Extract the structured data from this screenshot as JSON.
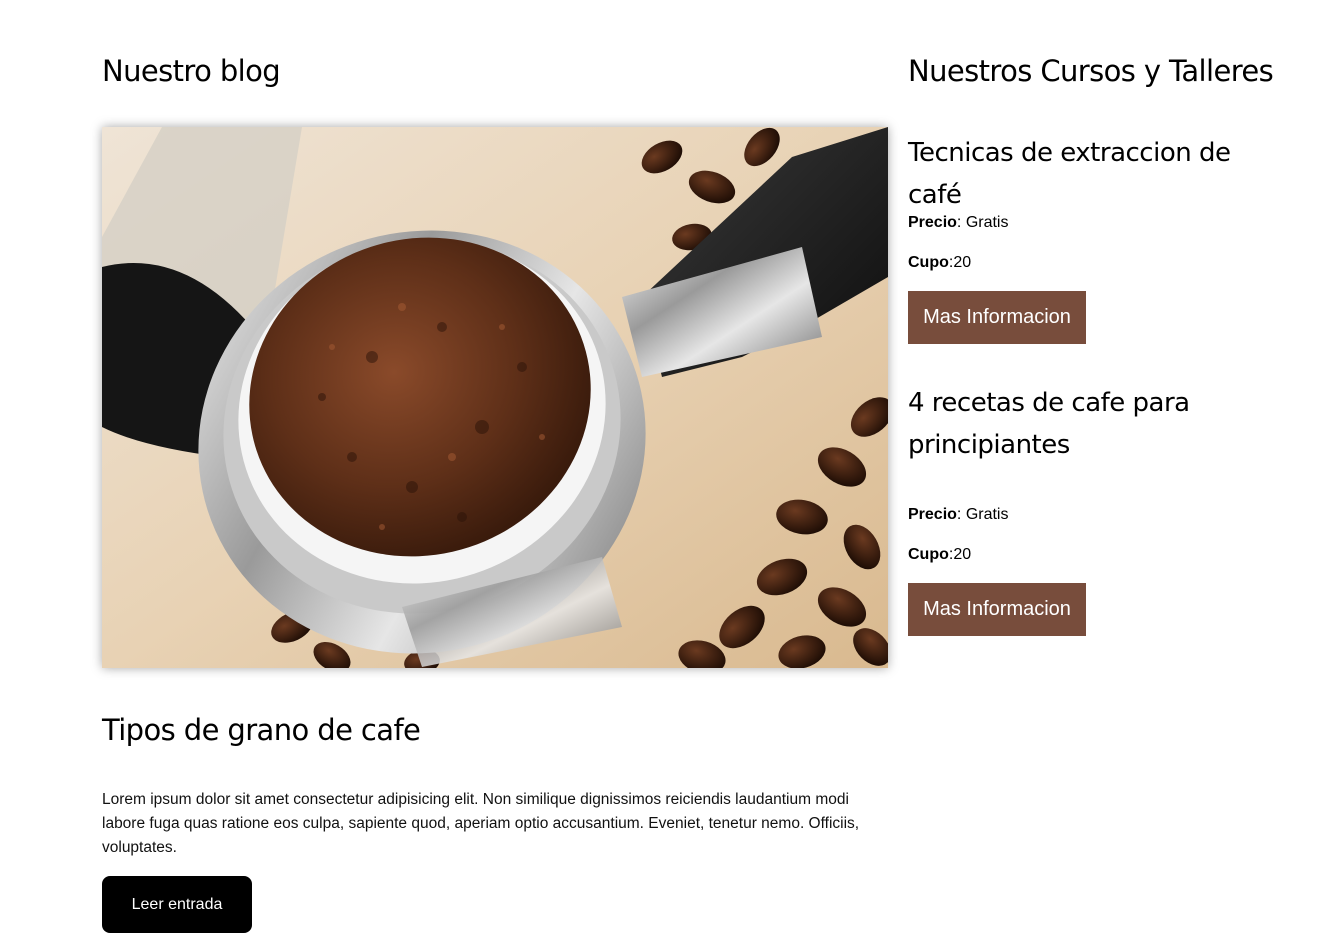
{
  "blog": {
    "heading": "Nuestro blog",
    "post": {
      "title": "Tipos de grano de cafe",
      "excerpt": "Lorem ipsum dolor sit amet consectetur adipisicing elit. Non similique dignissimos reiciendis laudantium modi labore fuga quas ratione eos culpa, sapiente quod, aperiam optio accusantium. Eveniet, tenetur nemo. Officiis, voluptates.",
      "button_label": "Leer entrada",
      "image_alt": "coffee-portafilter-photo"
    }
  },
  "courses": {
    "heading": "Nuestros Cursos y Talleres",
    "items": [
      {
        "title": "Tecnicas de extraccion de café",
        "price_label": "Precio",
        "price_value": ": Gratis",
        "cupo_label": "Cupo",
        "cupo_value": ":20",
        "button_label": "Mas Informacion"
      },
      {
        "title": "4 recetas de cafe para principiantes",
        "price_label": "Precio",
        "price_value": ": Gratis",
        "cupo_label": "Cupo",
        "cupo_value": ":20",
        "button_label": "Mas Informacion"
      }
    ]
  },
  "colors": {
    "button_brown": "#784d3c",
    "button_black": "#000000"
  }
}
